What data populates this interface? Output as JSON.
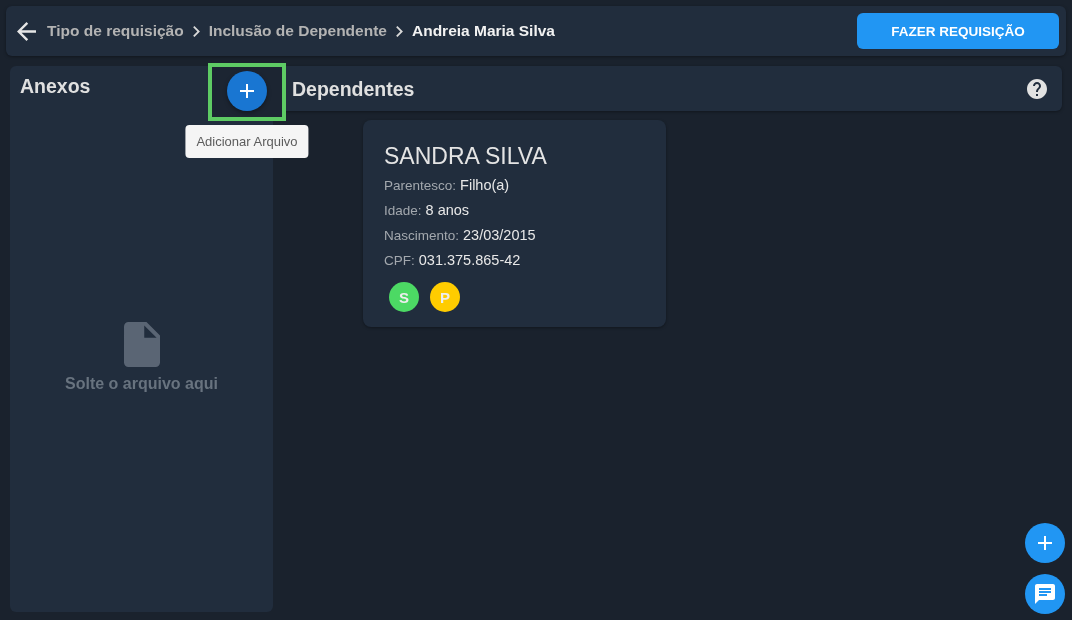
{
  "breadcrumb": [
    {
      "label": "Tipo de requisição",
      "current": false
    },
    {
      "label": "Inclusão de Dependente",
      "current": false
    },
    {
      "label": "Andreia Maria Silva",
      "current": true
    }
  ],
  "primary_button": {
    "label": "FAZER REQUISIÇÃO"
  },
  "attachments": {
    "title": "Anexos",
    "add_button": {
      "highlighted": true,
      "tooltip": "Adicionar Arquivo"
    },
    "dropzone": {
      "text": "Solte o arquivo aqui"
    }
  },
  "dependents": {
    "title": "Dependentes",
    "cards": [
      {
        "name": "SANDRA SILVA",
        "fields": [
          {
            "label": "Parentesco:",
            "value": "Filho(a)"
          },
          {
            "label": "Idade:",
            "value": "8 anos"
          },
          {
            "label": "Nascimento:",
            "value": "23/03/2015"
          },
          {
            "label": "CPF:",
            "value": "031.375.865-42"
          }
        ],
        "badges": [
          {
            "text": "S",
            "color": "#4cd964"
          },
          {
            "text": "P",
            "color": "#ffcc00"
          }
        ]
      }
    ]
  },
  "floating_buttons": [
    {
      "kind": "add"
    },
    {
      "kind": "chat"
    }
  ]
}
